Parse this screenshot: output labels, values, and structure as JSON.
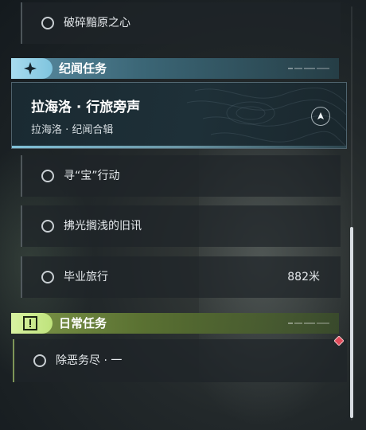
{
  "quests": {
    "top_row": {
      "label": "破碎黯原之心"
    },
    "world_quests": {
      "section_title": "纪闻任务",
      "featured": {
        "title": "拉海洛 · 行旅旁声",
        "subtitle": "拉海洛 · 纪闻合辑"
      },
      "items": [
        {
          "label": "寻“宝”行动"
        },
        {
          "label": "拂光搁浅的旧讯"
        },
        {
          "label": "毕业旅行",
          "distance": "882米"
        }
      ]
    },
    "daily_quests": {
      "section_title": "日常任务",
      "items": [
        {
          "label": "除恶务尽 · 一"
        }
      ]
    }
  },
  "icons": {
    "world_section": "sparkle-star-icon",
    "daily_section": "exclamation-box-icon",
    "featured_nav": "navigate-arrow-icon",
    "tracked_marker": "red-diamond-marker-icon"
  },
  "colors": {
    "world_accent": "#7fc4de",
    "daily_accent": "#bfe37c",
    "marker": "#e04a5a"
  }
}
